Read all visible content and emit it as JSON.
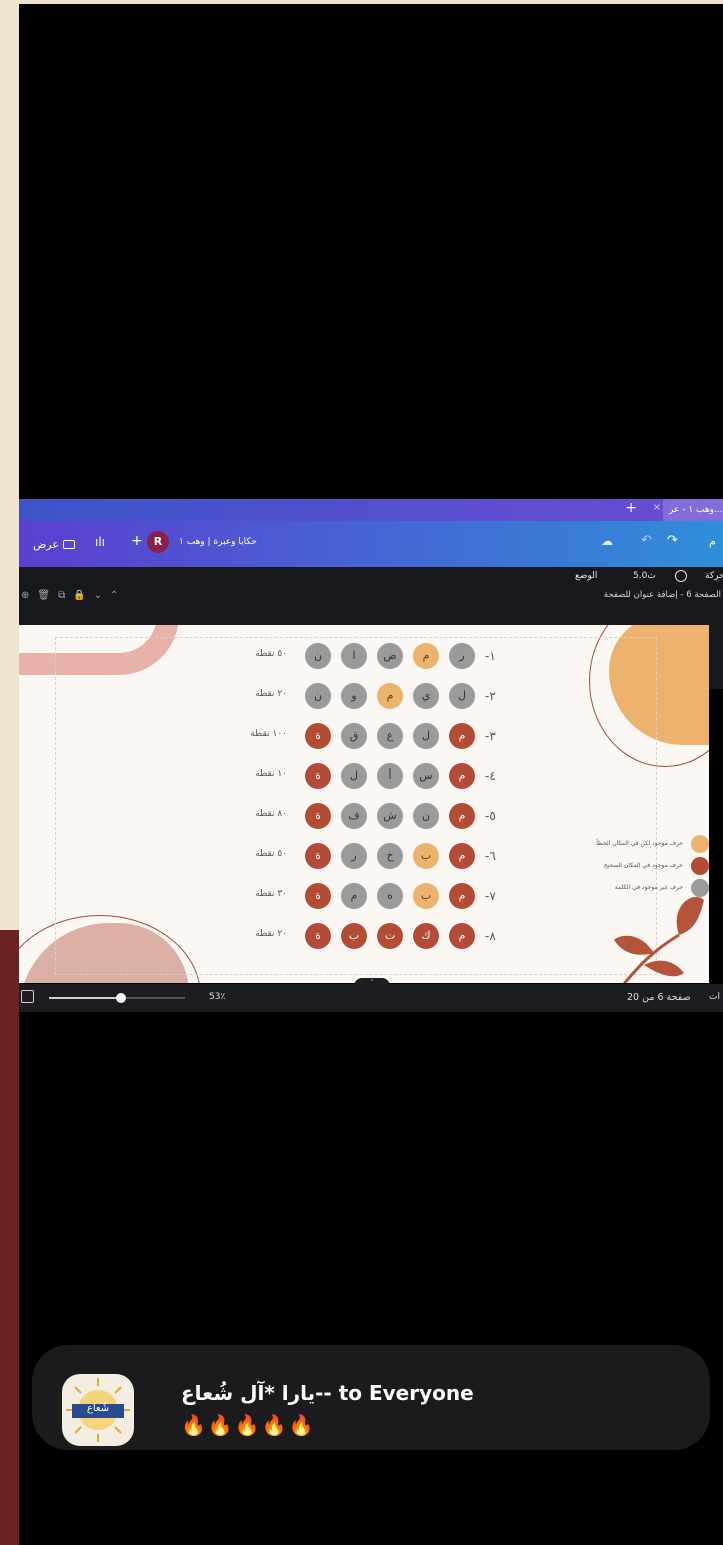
{
  "browser": {
    "tab_label": "وهب ١ - عر...",
    "tab_close": "×",
    "new_tab": "+"
  },
  "toolbar": {
    "present_label": "عرض",
    "doc_title": "حكايا وعبرة | وهب ١",
    "avatar_letter": "R",
    "add": "+",
    "menu_partial": "م"
  },
  "subbar": {
    "animate": "حركة",
    "duration": "5.0ث",
    "position": "الوضع"
  },
  "pagebar": {
    "page_label": "الصفحة 6 - إضافة عنوان للصفحة"
  },
  "slide": {
    "rows": [
      {
        "num": "-١",
        "points": "٥٠ نقطة",
        "cells": [
          [
            "ر",
            "g"
          ],
          [
            "م",
            "y"
          ],
          [
            "ض",
            "g"
          ],
          [
            "ا",
            "g"
          ],
          [
            "ن",
            "g"
          ]
        ]
      },
      {
        "num": "-٢",
        "points": "٢٠ نقطة",
        "cells": [
          [
            "ل",
            "g"
          ],
          [
            "ي",
            "g"
          ],
          [
            "م",
            "y"
          ],
          [
            "و",
            "g"
          ],
          [
            "ن",
            "g"
          ]
        ]
      },
      {
        "num": "-٣",
        "points": "١٠٠ نقطة",
        "cells": [
          [
            "م",
            "r"
          ],
          [
            "ل",
            "g"
          ],
          [
            "ع",
            "g"
          ],
          [
            "ق",
            "g"
          ],
          [
            "ة",
            "r"
          ]
        ]
      },
      {
        "num": "-٤",
        "points": "١٠ نقطة",
        "cells": [
          [
            "م",
            "r"
          ],
          [
            "س",
            "g"
          ],
          [
            "أ",
            "g"
          ],
          [
            "ل",
            "g"
          ],
          [
            "ة",
            "r"
          ]
        ]
      },
      {
        "num": "-٥",
        "points": "٨٠ نقطة",
        "cells": [
          [
            "م",
            "r"
          ],
          [
            "ن",
            "g"
          ],
          [
            "ش",
            "g"
          ],
          [
            "ف",
            "g"
          ],
          [
            "ة",
            "r"
          ]
        ]
      },
      {
        "num": "-٦",
        "points": "٥٠ نقطة",
        "cells": [
          [
            "م",
            "r"
          ],
          [
            "ب",
            "y"
          ],
          [
            "خ",
            "g"
          ],
          [
            "ر",
            "g"
          ],
          [
            "ة",
            "r"
          ]
        ]
      },
      {
        "num": "-٧",
        "points": "٣٠ نقطة",
        "cells": [
          [
            "م",
            "r"
          ],
          [
            "ب",
            "y"
          ],
          [
            "ه",
            "g"
          ],
          [
            "م",
            "g"
          ],
          [
            "ة",
            "r"
          ]
        ]
      },
      {
        "num": "-٨",
        "points": "٢٠ نقطة",
        "cells": [
          [
            "م",
            "r"
          ],
          [
            "ك",
            "r"
          ],
          [
            "ت",
            "r"
          ],
          [
            "ب",
            "r"
          ],
          [
            "ة",
            "r"
          ]
        ]
      }
    ],
    "legend": [
      {
        "text": "حرف موجود لكن في المكان الخطأ",
        "color": "#ecb26e"
      },
      {
        "text": "حرف موجود في المكان الصحيح",
        "color": "#b44b35"
      },
      {
        "text": "حرف غير موجود في الكلمة",
        "color": "#9a9a9a"
      }
    ]
  },
  "status": {
    "zoom": "53٪",
    "zoom_fraction": 0.53,
    "page": "صفحة 6 من 20",
    "notes": "ات"
  },
  "notification": {
    "title": "يارا *آل شُعاع-- to Everyone",
    "body": "🔥🔥🔥🔥🔥",
    "app_icon_text": "شُعاع"
  }
}
